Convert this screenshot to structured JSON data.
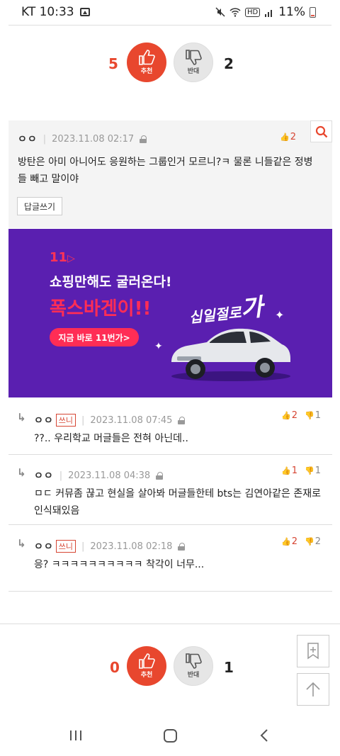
{
  "status_bar": {
    "carrier_time": "KT 10:33",
    "hd": "HD",
    "battery": "11%"
  },
  "top_vote": {
    "up_count": "5",
    "up_label": "추천",
    "down_label": "반대",
    "down_count": "2"
  },
  "best_comment": {
    "nickname": "ㅇㅇ",
    "timestamp": "2023.11.08 02:17",
    "up_count": "2",
    "text": "방탄은 아미 아니어도 응원하는 그룹인거 모르니?ㅋ 물론 니들같은 정병들 빼고 말이야",
    "reply_label": "답글쓰기"
  },
  "ad": {
    "logo": "11",
    "line1": "쇼핑만해도 굴러온다!",
    "line2": "폭스바겐이!!",
    "slogan_small": "십일절로",
    "slogan_big": "가",
    "cta": "지금 바로 11번가>"
  },
  "replies": [
    {
      "nickname": "ㅇㅇ",
      "badge": "쓰니",
      "timestamp": "2023.11.08 07:45",
      "up_count": "2",
      "down_count": "1",
      "text": "??.. 우리학교 머글들은 전혀 아닌데.."
    },
    {
      "nickname": "ㅇㅇ",
      "badge": "",
      "timestamp": "2023.11.08 04:38",
      "up_count": "1",
      "down_count": "1",
      "text": "ㅁㄷ 커뮤좀 끊고 현실을 살아봐 머글들한테 bts는 김연아같은 존재로 인식돼있음"
    },
    {
      "nickname": "ㅇㅇ",
      "badge": "쓰니",
      "timestamp": "2023.11.08 02:18",
      "up_count": "2",
      "down_count": "2",
      "text": "응? ㅋㅋㅋㅋㅋㅋㅋㅋㅋㅋ 착각이 너무..."
    }
  ],
  "bottom_vote": {
    "up_count": "0",
    "up_label": "추천",
    "down_label": "반대",
    "down_count": "1"
  },
  "icons": {
    "reply_arrow": "↳",
    "search": "search-icon",
    "bookmark": "bookmark-add-icon",
    "scroll_top": "arrow-up-icon"
  },
  "colors": {
    "accent": "#e8472e",
    "ad_bg": "#5a1fb0",
    "ad_pink": "#ff2d55"
  }
}
